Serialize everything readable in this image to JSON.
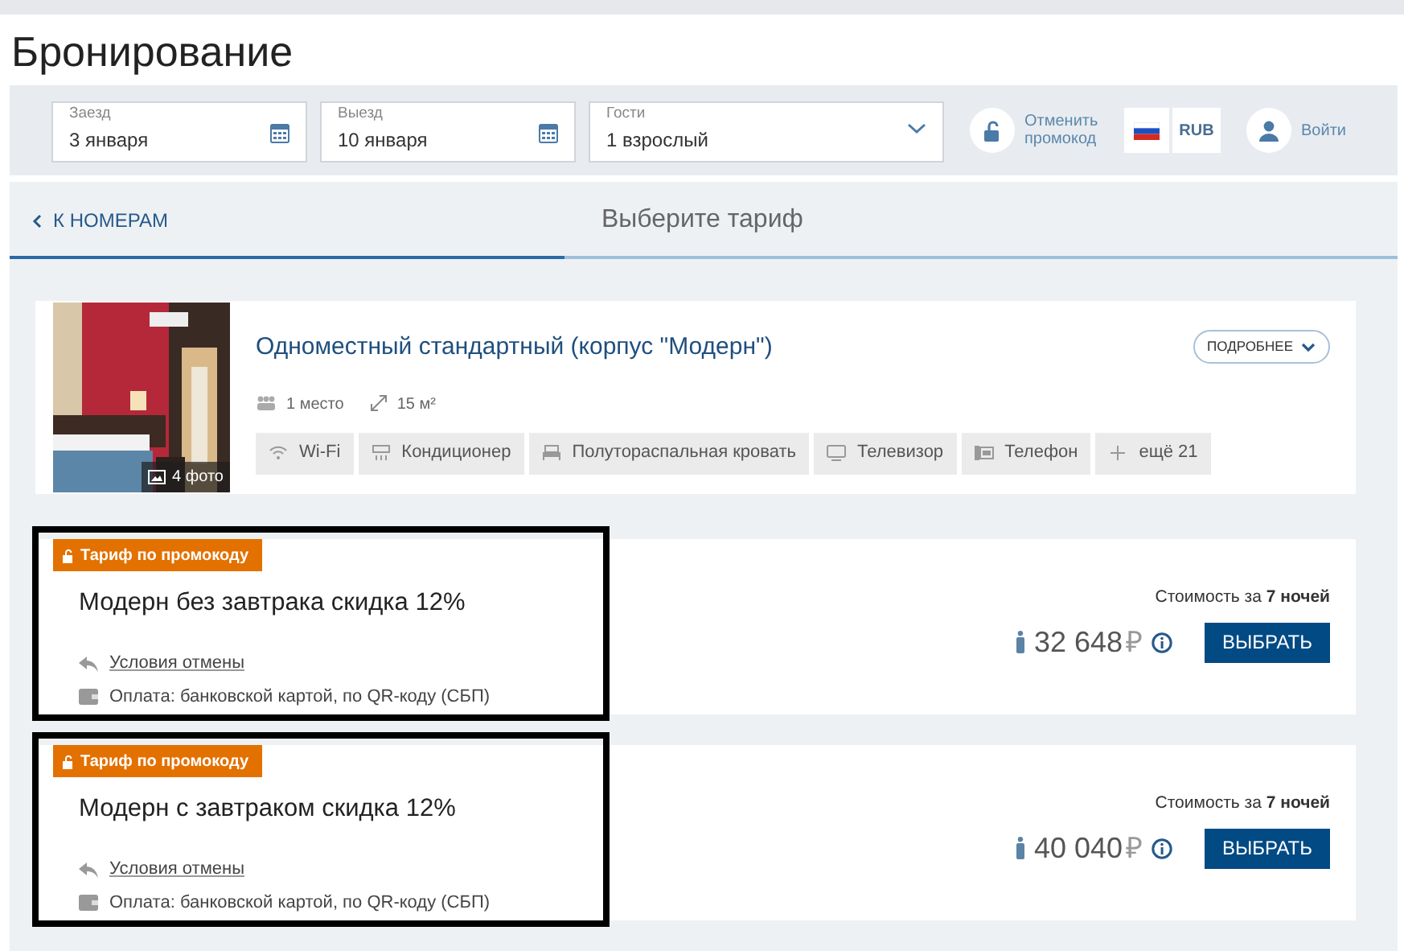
{
  "page_title": "Бронирование",
  "search": {
    "fields": [
      {
        "kind": "date",
        "label": "Заезд",
        "value": "3 января"
      },
      {
        "kind": "date",
        "label": "Выезд",
        "value": "10 января"
      },
      {
        "kind": "select",
        "label": "Гости",
        "value": "1 взрослый"
      }
    ],
    "promo_action": "Отменить промокод",
    "currency": "RUB",
    "login": "Войти"
  },
  "nav": {
    "back": "К НОМЕРАМ",
    "step": "Выберите тариф",
    "level": 0.4
  },
  "room": {
    "photo_count": "4 фото",
    "name": "Одноместный стандартный (корпус \"Модерн\")",
    "details_button": "ПОДРОБНЕЕ",
    "guests": "1 место",
    "area": "15 м²",
    "amenities": [
      {
        "kind": "wifi",
        "label": "Wi-Fi"
      },
      {
        "kind": "ac",
        "label": "Кондиционер"
      },
      {
        "kind": "bed",
        "label": "Полутораспальная кровать"
      },
      {
        "kind": "tv",
        "label": "Телевизор"
      },
      {
        "kind": "phone",
        "label": "Телефон"
      },
      {
        "kind": "more",
        "label": "ещё 21"
      }
    ]
  },
  "tariffs": [
    {
      "badge": "Тариф по промокоду",
      "name": "Модерн без завтрака скидка 12%",
      "cancel_link": "Условия отмены",
      "payment": "Оплата: банковской картой, по QR-коду (СБП)",
      "cost_label": "Стоимость за **7 ночей**",
      "price": "32 648",
      "currency": "₽",
      "button": "ВЫБРАТЬ",
      "highlighted": true
    },
    {
      "badge": "Тариф по промокоду",
      "name": "Модерн с завтраком скидка 12%",
      "cancel_link": "Условия отмены",
      "payment": "Оплата: банковской картой, по QR-коду (СБП)",
      "cost_label": "Стоимость за **7 ночей**",
      "price": "40 040",
      "currency": "₽",
      "button": "ВЫБРАТЬ",
      "highlighted": true
    }
  ]
}
